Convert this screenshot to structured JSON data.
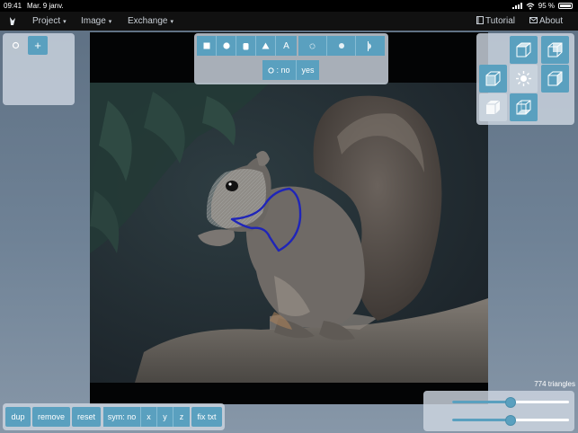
{
  "status_bar": {
    "time": "09:41",
    "date": "Mar. 9 janv.",
    "battery": "95 %"
  },
  "menu": {
    "items": [
      {
        "label": "Project",
        "caret": "▾"
      },
      {
        "label": "Image",
        "caret": "▾"
      },
      {
        "label": "Exchange",
        "caret": "▾"
      }
    ],
    "tutorial_label": "Tutorial",
    "about_label": "About"
  },
  "left_panel": {
    "add_label": "+"
  },
  "shape_toolbar": {
    "text_tool_label": "A",
    "toggle_label": ": no",
    "yes_label": "yes"
  },
  "triangle_count": "774 triangles",
  "bottom_toolbar": {
    "dup": "dup",
    "remove": "remove",
    "reset": "reset",
    "sym": "sym: no",
    "x": "x",
    "y": "y",
    "z": "z",
    "fix_txt": "fix txt"
  },
  "sliders": [
    {
      "value": 0.5
    },
    {
      "value": 0.5
    }
  ],
  "colors": {
    "accent": "#5aa0bf",
    "panel": "#cdd6e0",
    "background": "#6f8296",
    "contour": "#1f25b8"
  }
}
